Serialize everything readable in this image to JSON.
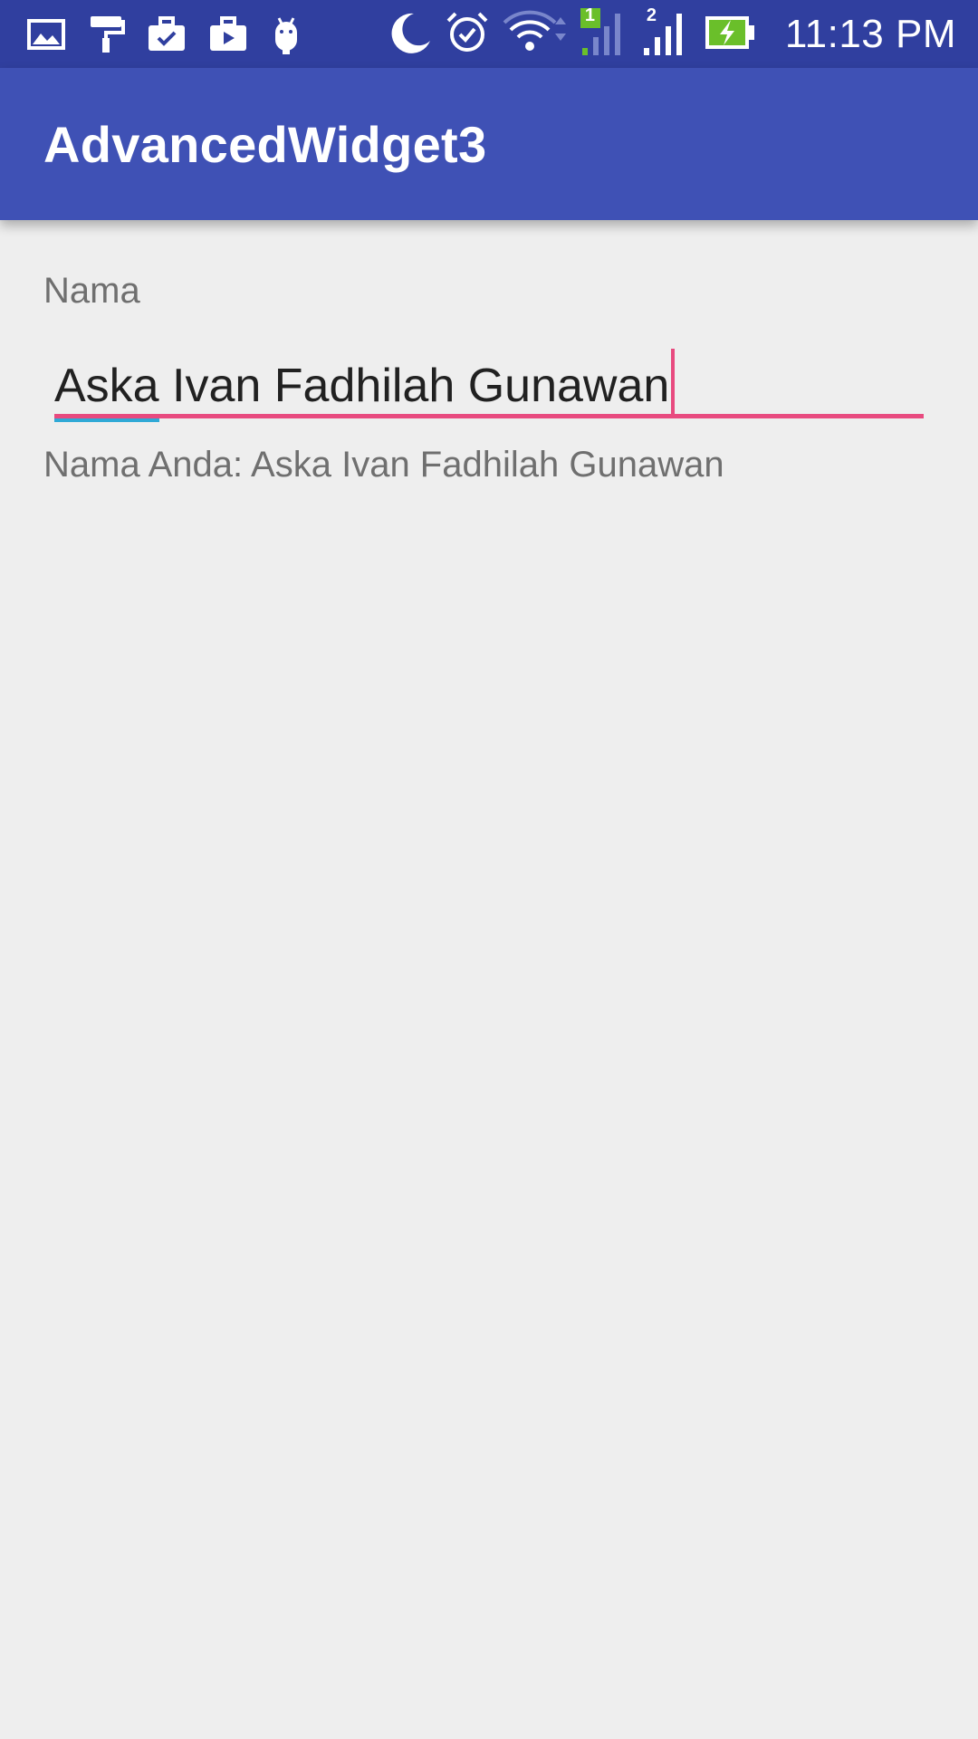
{
  "status_bar": {
    "time": "11:13 PM",
    "sim1_label": "1",
    "sim2_label": "2",
    "icons": [
      "gallery-icon",
      "paint-roller-icon",
      "briefcase-check-icon",
      "briefcase-play-icon",
      "android-icon",
      "moon-icon",
      "alarm-icon",
      "wifi-icon",
      "signal-sim1-icon",
      "signal-sim2-icon",
      "battery-charging-icon"
    ]
  },
  "app_bar": {
    "title": "AdvancedWidget3"
  },
  "form": {
    "label": "Nama",
    "input_first_word": "Aska",
    "input_rest": " Ivan Fadhilah Gunawan",
    "result": "Nama Anda: Aska Ivan Fadhilah Gunawan"
  },
  "colors": {
    "status_bar": "#303f9f",
    "app_bar": "#3f51b5",
    "accent": "#e84a7f",
    "spellcheck": "#2fa9d6",
    "background": "#eeeeee"
  }
}
